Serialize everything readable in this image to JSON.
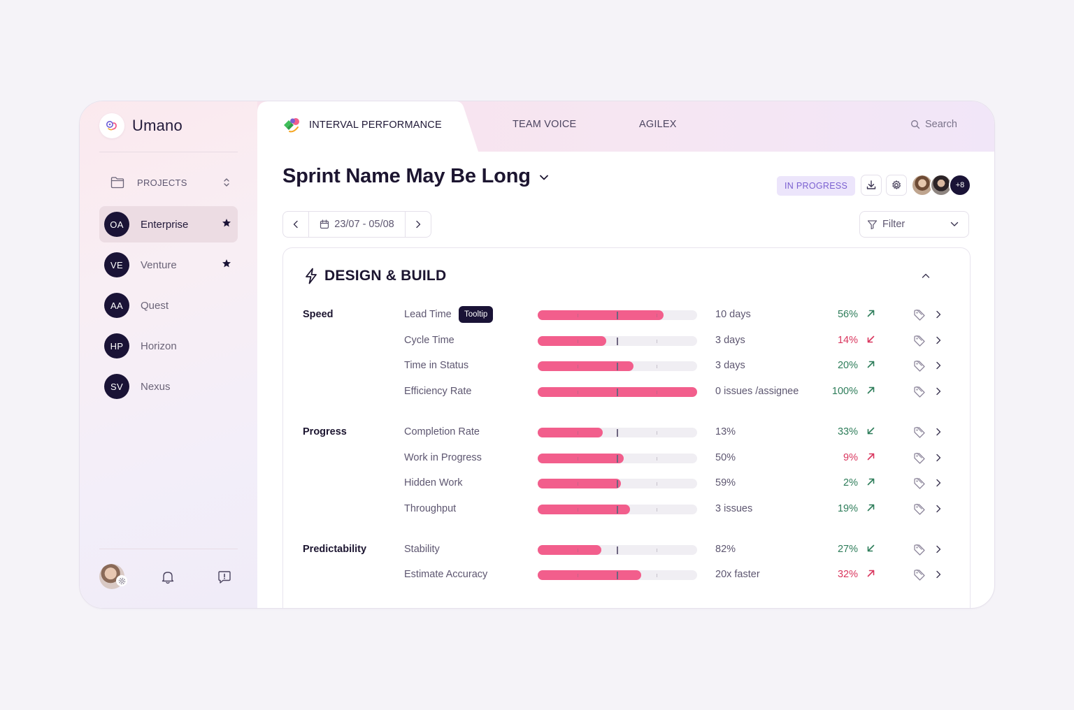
{
  "app": {
    "name": "Umano",
    "colors": {
      "accent": "#f25e8c",
      "dark": "#1a1336",
      "good": "#2e7d5a",
      "bad": "#d9365e",
      "status": "#7a5fd0"
    }
  },
  "sidebar": {
    "projects_label": "PROJECTS",
    "items": [
      {
        "initials": "OA",
        "name": "Enterprise",
        "starred": true,
        "active": true
      },
      {
        "initials": "VE",
        "name": "Venture",
        "starred": true,
        "active": false
      },
      {
        "initials": "AA",
        "name": "Quest",
        "starred": false,
        "active": false
      },
      {
        "initials": "HP",
        "name": "Horizon",
        "starred": false,
        "active": false
      },
      {
        "initials": "SV",
        "name": "Nexus",
        "starred": false,
        "active": false
      }
    ]
  },
  "tabs": [
    {
      "label": "INTERVAL PERFORMANCE",
      "active": true
    },
    {
      "label": "TEAM VOICE",
      "active": false
    },
    {
      "label": "AGILEX",
      "active": false
    }
  ],
  "search": {
    "placeholder": "Search"
  },
  "header": {
    "title": "Sprint Name May Be Long",
    "status": "IN PROGRESS",
    "extra_members": "+8"
  },
  "date_range": "23/07 - 05/08",
  "filter": {
    "label": "Filter"
  },
  "section": {
    "title": "DESIGN & BUILD",
    "rows": [
      {
        "group": "Speed",
        "metric": "Lead Time",
        "tooltip": "Tooltip",
        "value": "10 days",
        "progress": 0.79,
        "change": "56%",
        "trend": "up",
        "status": "good"
      },
      {
        "group": "",
        "metric": "Cycle Time",
        "value": "3 days",
        "progress": 0.43,
        "change": "14%",
        "trend": "down",
        "status": "bad"
      },
      {
        "group": "",
        "metric": "Time in Status",
        "value": "3 days",
        "progress": 0.6,
        "change": "20%",
        "trend": "up",
        "status": "good"
      },
      {
        "group": "",
        "metric": "Efficiency Rate",
        "value": "0 issues /assignee",
        "progress": 1.0,
        "change": "100%",
        "trend": "up",
        "status": "good"
      },
      {
        "group": "Progress",
        "metric": "Completion Rate",
        "value": "13%",
        "progress": 0.41,
        "change": "33%",
        "trend": "down",
        "status": "good"
      },
      {
        "group": "",
        "metric": "Work in Progress",
        "value": "50%",
        "progress": 0.54,
        "change": "9%",
        "trend": "up",
        "status": "bad"
      },
      {
        "group": "",
        "metric": "Hidden Work",
        "value": "59%",
        "progress": 0.52,
        "change": "2%",
        "trend": "up",
        "status": "good"
      },
      {
        "group": "",
        "metric": "Throughput",
        "value": "3 issues",
        "progress": 0.58,
        "change": "19%",
        "trend": "up",
        "status": "good"
      },
      {
        "group": "Predictability",
        "metric": "Stability",
        "value": "82%",
        "progress": 0.4,
        "change": "27%",
        "trend": "down",
        "status": "good"
      },
      {
        "group": "",
        "metric": "Estimate Accuracy",
        "value": "20x faster",
        "progress": 0.65,
        "change": "32%",
        "trend": "up",
        "status": "bad"
      }
    ]
  }
}
